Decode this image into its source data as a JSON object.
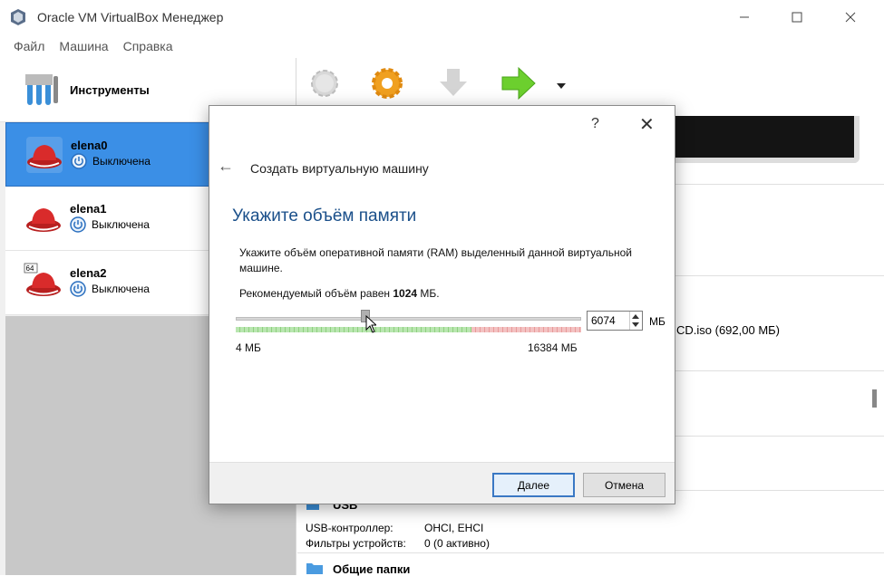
{
  "window": {
    "title": "Oracle VM VirtualBox Менеджер"
  },
  "menu": [
    "Файл",
    "Машина",
    "Справка"
  ],
  "tools": {
    "label": "Инструменты"
  },
  "vms": [
    {
      "name": "elena0",
      "status": "Выключена",
      "selected": true
    },
    {
      "name": "elena1",
      "status": "Выключена",
      "selected": false
    },
    {
      "name": "elena2",
      "status": "Выключена",
      "selected": false,
      "badge": "64"
    }
  ],
  "details": {
    "storage_fragment": "CD.iso (692,00 МБ)",
    "usb_title": "USB",
    "usb_controller_label": "USB-контроллер:",
    "usb_controller_value": "OHCI, EHCI",
    "usb_filters_label": "Фильтры устройств:",
    "usb_filters_value": "0 (0 активно)",
    "shared_title": "Общие папки"
  },
  "dialog": {
    "help": "?",
    "close": "✕",
    "back": "←",
    "wizard_title": "Создать виртуальную машину",
    "heading": "Укажите объём памяти",
    "description": "Укажите объём оперативной памяти (RAM) выделенный данной виртуальной машине.",
    "recommended_prefix": "Рекомендуемый объём равен ",
    "recommended_value": "1024",
    "recommended_suffix": " МБ.",
    "slider_min": "4 МБ",
    "slider_max": "16384 МБ",
    "memory_value": "6074",
    "memory_unit": "МБ",
    "next_button": "Далее",
    "cancel_button": "Отмена"
  },
  "colors": {
    "selection": "#3b8fe6",
    "heading": "#1a4f8a"
  }
}
